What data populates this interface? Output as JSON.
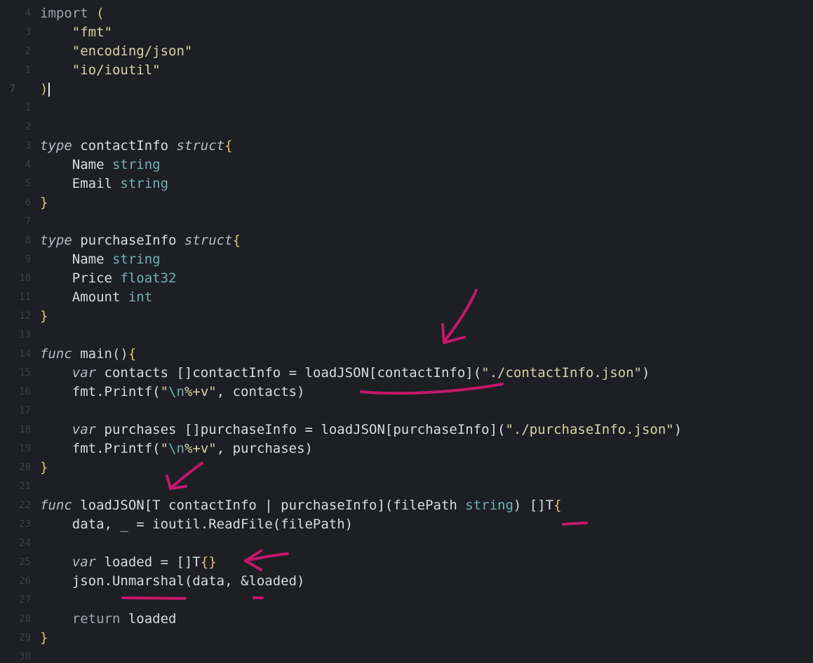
{
  "editor": {
    "current_line_number": "7",
    "lines": [
      {
        "ln": "4",
        "tokens": [
          {
            "c": "kw",
            "t": "import"
          },
          {
            "c": "op",
            "t": " "
          },
          {
            "c": "br",
            "t": "("
          }
        ]
      },
      {
        "ln": "3",
        "tokens": [
          {
            "c": "str",
            "t": "    \"fmt\""
          }
        ]
      },
      {
        "ln": "2",
        "tokens": [
          {
            "c": "str",
            "t": "    \"encoding/json\""
          }
        ]
      },
      {
        "ln": "1",
        "tokens": [
          {
            "c": "str",
            "t": "    \"io/ioutil\""
          }
        ]
      },
      {
        "ln": "",
        "cursor": true,
        "tokens": [
          {
            "c": "br",
            "t": ")"
          }
        ]
      },
      {
        "ln": "1",
        "tokens": []
      },
      {
        "ln": "2",
        "tokens": []
      },
      {
        "ln": "3",
        "tokens": [
          {
            "c": "kwi",
            "t": "type"
          },
          {
            "c": "id",
            "t": " contactInfo "
          },
          {
            "c": "kwi",
            "t": "struct"
          },
          {
            "c": "br",
            "t": "{"
          }
        ]
      },
      {
        "ln": "4",
        "tokens": [
          {
            "c": "id",
            "t": "    Name "
          },
          {
            "c": "typ",
            "t": "string"
          }
        ]
      },
      {
        "ln": "5",
        "tokens": [
          {
            "c": "id",
            "t": "    Email "
          },
          {
            "c": "typ",
            "t": "string"
          }
        ]
      },
      {
        "ln": "6",
        "tokens": [
          {
            "c": "br",
            "t": "}"
          }
        ]
      },
      {
        "ln": "7",
        "tokens": []
      },
      {
        "ln": "8",
        "tokens": [
          {
            "c": "kwi",
            "t": "type"
          },
          {
            "c": "id",
            "t": " purchaseInfo "
          },
          {
            "c": "kwi",
            "t": "struct"
          },
          {
            "c": "br",
            "t": "{"
          }
        ]
      },
      {
        "ln": "9",
        "tokens": [
          {
            "c": "id",
            "t": "    Name "
          },
          {
            "c": "typ",
            "t": "string"
          }
        ]
      },
      {
        "ln": "10",
        "tokens": [
          {
            "c": "id",
            "t": "    Price "
          },
          {
            "c": "typ",
            "t": "float32"
          }
        ]
      },
      {
        "ln": "11",
        "tokens": [
          {
            "c": "id",
            "t": "    Amount "
          },
          {
            "c": "typ",
            "t": "int"
          }
        ]
      },
      {
        "ln": "12",
        "tokens": [
          {
            "c": "br",
            "t": "}"
          }
        ]
      },
      {
        "ln": "13",
        "tokens": []
      },
      {
        "ln": "14",
        "tokens": [
          {
            "c": "kwi",
            "t": "func"
          },
          {
            "c": "id",
            "t": " main"
          },
          {
            "c": "op",
            "t": "()"
          },
          {
            "c": "br",
            "t": "{"
          }
        ]
      },
      {
        "ln": "15",
        "tokens": [
          {
            "c": "op",
            "t": "    "
          },
          {
            "c": "kwi",
            "t": "var"
          },
          {
            "c": "id",
            "t": " contacts []contactInfo = loadJSON[contactInfo]("
          },
          {
            "c": "str",
            "t": "\"./contactInfo.json\""
          },
          {
            "c": "id",
            "t": ")"
          }
        ]
      },
      {
        "ln": "16",
        "tokens": [
          {
            "c": "id",
            "t": "    fmt.Printf("
          },
          {
            "c": "str",
            "t": "\""
          },
          {
            "c": "typ",
            "t": "\\n"
          },
          {
            "c": "str",
            "t": "%+v\""
          },
          {
            "c": "id",
            "t": ", contacts)"
          }
        ]
      },
      {
        "ln": "17",
        "tokens": []
      },
      {
        "ln": "18",
        "tokens": [
          {
            "c": "op",
            "t": "    "
          },
          {
            "c": "kwi",
            "t": "var"
          },
          {
            "c": "id",
            "t": " purchases []purchaseInfo = loadJSON[purchaseInfo]("
          },
          {
            "c": "str",
            "t": "\"./purchaseInfo.json\""
          },
          {
            "c": "id",
            "t": ")"
          }
        ]
      },
      {
        "ln": "19",
        "tokens": [
          {
            "c": "id",
            "t": "    fmt.Printf("
          },
          {
            "c": "str",
            "t": "\""
          },
          {
            "c": "typ",
            "t": "\\n"
          },
          {
            "c": "str",
            "t": "%+v\""
          },
          {
            "c": "id",
            "t": ", purchases)"
          }
        ]
      },
      {
        "ln": "20",
        "tokens": [
          {
            "c": "br",
            "t": "}"
          }
        ]
      },
      {
        "ln": "21",
        "tokens": []
      },
      {
        "ln": "22",
        "tokens": [
          {
            "c": "kwi",
            "t": "func"
          },
          {
            "c": "id",
            "t": " loadJSON[T contactInfo | purchaseInfo](filePath "
          },
          {
            "c": "typ",
            "t": "string"
          },
          {
            "c": "id",
            "t": ") []T"
          },
          {
            "c": "br",
            "t": "{"
          }
        ]
      },
      {
        "ln": "23",
        "tokens": [
          {
            "c": "id",
            "t": "    data, _ = ioutil.ReadFile(filePath)"
          }
        ]
      },
      {
        "ln": "24",
        "tokens": []
      },
      {
        "ln": "25",
        "tokens": [
          {
            "c": "op",
            "t": "    "
          },
          {
            "c": "kwi",
            "t": "var"
          },
          {
            "c": "id",
            "t": " loaded = []T"
          },
          {
            "c": "br",
            "t": "{}"
          }
        ]
      },
      {
        "ln": "26",
        "tokens": [
          {
            "c": "id",
            "t": "    json.Unmarshal(data, &loaded)"
          }
        ]
      },
      {
        "ln": "27",
        "tokens": []
      },
      {
        "ln": "28",
        "tokens": [
          {
            "c": "op",
            "t": "    "
          },
          {
            "c": "kw",
            "t": "return"
          },
          {
            "c": "id",
            "t": " loaded"
          }
        ]
      },
      {
        "ln": "29",
        "tokens": [
          {
            "c": "br",
            "t": "}"
          }
        ]
      },
      {
        "ln": "30",
        "tokens": []
      }
    ]
  },
  "colors": {
    "background": "#1d1f25",
    "annotation": "#c2186b"
  }
}
